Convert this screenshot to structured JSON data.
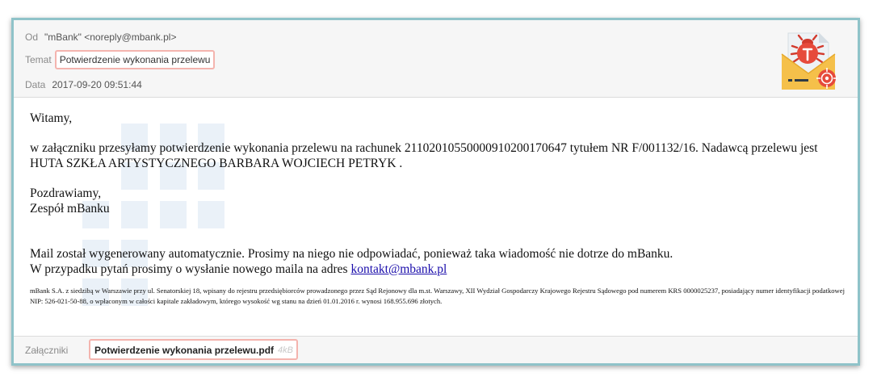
{
  "header": {
    "from_label": "Od",
    "from_value": "\"mBank\" <noreply@mbank.pl>",
    "subject_label": "Temat",
    "subject_value": "Potwierdzenie wykonania przelewu",
    "date_label": "Data",
    "date_value": "2017-09-20 09:51:44",
    "icon": "malware-envelope-icon"
  },
  "body": {
    "greeting": "Witamy,",
    "para1": "w załączniku przesyłamy potwierdzenie wykonania przelewu na rachunek 21102010550000910200170647 tytułem NR F/001132/16. Nadawcą przelewu jest HUTA SZKŁA ARTYSTYCZNEGO BARBARA WOJCIECH PETRYK .",
    "regards": "Pozdrawiamy,",
    "team": "Zespół mBanku",
    "auto_notice": "Mail został wygenerowany automatycznie. Prosimy na niego nie odpowiadać, ponieważ taka wiadomość nie dotrze do mBanku.",
    "contact_text": "W przypadku pytań prosimy o wysłanie nowego maila na adres",
    "contact_link": "kontakt@mbank.pl",
    "legal": "mBank S.A. z siedzibą w Warszawie przy ul. Senatorskiej 18, wpisany do rejestru przedsiębiorców prowadzonego przez Sąd Rejonowy dla m.st. Warszawy, XII Wydział Gospodarczy Krajowego Rejestru Sądowego pod numerem KRS 0000025237, posiadający numer identyfikacji podatkowej NIP: 526-021-50-88, o wpłaconym w całości kapitale zakładowym, którego wysokość wg stanu na dzień 01.01.2016 r. wynosi 168.955.696 złotych."
  },
  "attachments": {
    "label": "Załączniki",
    "file_name": "Potwierdzenie wykonania przelewu.pdf",
    "file_size": "4kB"
  },
  "colors": {
    "frame_border": "#8fc3c9",
    "highlight_border": "#f4b4ae",
    "icon_bug": "#e64a3b",
    "icon_envelope": "#f5c04a"
  }
}
